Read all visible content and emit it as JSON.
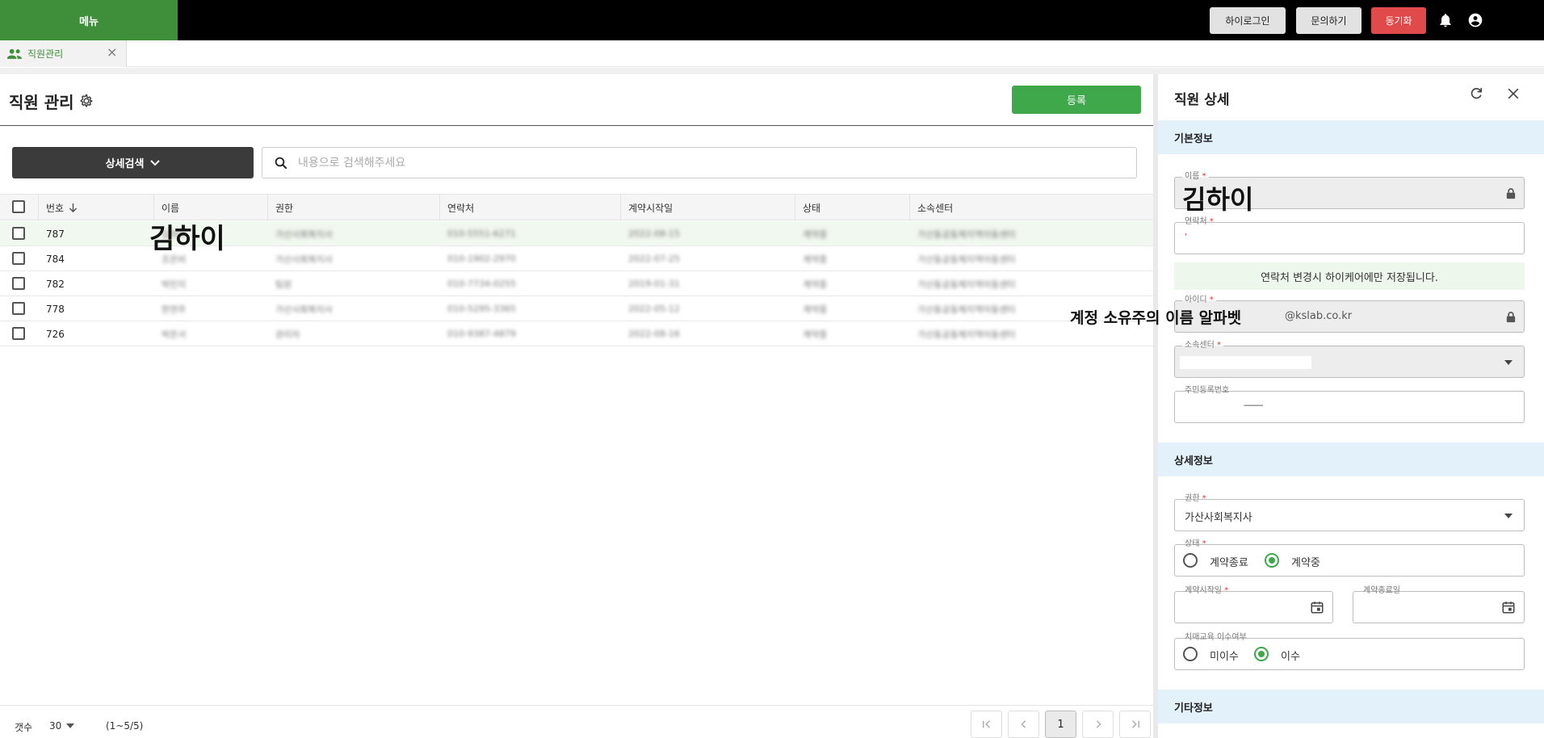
{
  "topbar": {
    "menu_label": "메뉴",
    "login_label": "하이로그인",
    "inquiry_label": "문의하기",
    "sync_label": "동기화"
  },
  "tabs": [
    {
      "label": "직원관리"
    }
  ],
  "page": {
    "title": "직원 관리",
    "register_label": "등록",
    "detail_search_label": "상세검색",
    "search_placeholder": "내용으로 검색해주세요"
  },
  "table": {
    "columns": [
      "번호",
      "이름",
      "권한",
      "연락처",
      "계약시작일",
      "상태",
      "소속센터"
    ],
    "rows": [
      {
        "no": "787",
        "name": "김하이",
        "role": "가산사회복지사",
        "phone": "010-5551-6271",
        "start": "2022-08-15",
        "status": "계약중",
        "center": "가산동공동체지역아동센터"
      },
      {
        "no": "784",
        "name": "조은비",
        "role": "가산사회복지사",
        "phone": "010-1902-2970",
        "start": "2022-07-25",
        "status": "계약중",
        "center": "가산동공동체지역아동센터"
      },
      {
        "no": "782",
        "name": "박민지",
        "role": "팀원",
        "phone": "010-7734-0255",
        "start": "2019-01-31",
        "status": "계약중",
        "center": "가산동공동체지역아동센터"
      },
      {
        "no": "778",
        "name": "한연주",
        "role": "가산사회복지사",
        "phone": "010-5295-3365",
        "start": "2022-05-12",
        "status": "계약중",
        "center": "가산동공동체지역아동센터"
      },
      {
        "no": "726",
        "name": "박은서",
        "role": "관리자",
        "phone": "010-9387-4879",
        "start": "2022-08-16",
        "status": "계약중",
        "center": "가산동공동체지역아동센터"
      }
    ],
    "highlight_name": "김하이"
  },
  "footer": {
    "count_label": "갯수",
    "count_value": "30",
    "range_text": "(1~5/5)",
    "current_page": "1"
  },
  "detail": {
    "title": "직원 상세",
    "section_basic": "기본정보",
    "name_label": "이름",
    "name_value": "김하이",
    "phone_label": "연락처",
    "phone_value": "'",
    "phone_notice": "연락처 변경시 하이케어에만 저장됩니다.",
    "id_label": "아이디",
    "id_overlay": "계정 소유주의 이름 알파벳",
    "id_domain": "@kslab.co.kr",
    "center_label": "소속센터",
    "rrn_label": "주민등록번호",
    "rrn_value": "---------",
    "section_detail": "상세정보",
    "role_label": "권한",
    "role_value": "가산사회복지사",
    "status_label": "상태",
    "status_options": [
      "계약종료",
      "계약중"
    ],
    "status_selected": "계약중",
    "start_label": "계약시작일",
    "end_label": "계약종료일",
    "dementia_label": "치매교육 이수여부",
    "dementia_options": [
      "미이수",
      "이수"
    ],
    "dementia_selected": "이수",
    "section_other": "기타정보"
  },
  "colors": {
    "brand_green": "#3e8e3a",
    "button_green": "#3ea84b",
    "sync_red": "#e04a4a",
    "section_blue": "#e3f1fb"
  }
}
